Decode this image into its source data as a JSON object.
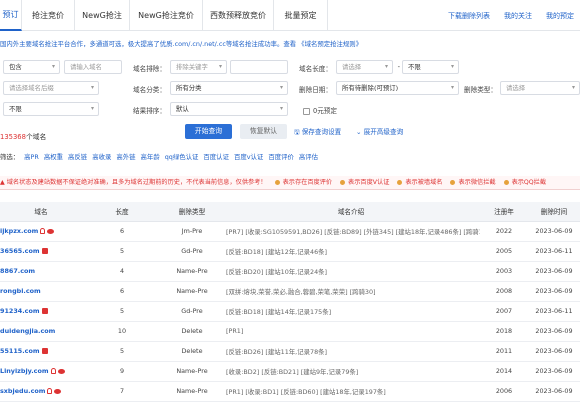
{
  "nav": {
    "tabs": [
      {
        "label": "预订",
        "active": true
      },
      {
        "label": "抢注竞价",
        "active": false
      },
      {
        "label": "NewG抢注",
        "active": false
      },
      {
        "label": "NewG抢注竞价",
        "active": false
      },
      {
        "label": "西数预释放竞价",
        "active": false
      },
      {
        "label": "批量预定",
        "active": false
      }
    ],
    "links": [
      "下载删除列表",
      "我的关注",
      "我的预定"
    ]
  },
  "notice": "国内外主要域名抢注平台合作，多通道可选，极大提高了优质.com/.cn/.net/.cc等域名抢注成功率。查看 《域名预定抢注规则》",
  "form": {
    "row1": {
      "contains_select": "包含",
      "keyword_placeholder": "请输入域名",
      "exclude_label": "域名排除：",
      "exclude_select": "排除关键字",
      "length_label": "域名长度：",
      "length_placeholder": "请选择",
      "length_limit": "不限"
    },
    "row2": {
      "suffix_placeholder": "请选择域名后缀",
      "category_label": "域名分类：",
      "category_value": "所有分类",
      "delete_date_label": "删除日期：",
      "delete_date_value": "所有待删除(可预订)",
      "delete_type_label": "删除类型：",
      "delete_type_placeholder": "请选择"
    },
    "row3": {
      "limit_select": "不限",
      "sort_label": "结果排序：",
      "sort_value": "默认",
      "price_label": "0元预定"
    },
    "row4": {
      "search_button": "开始查询",
      "reset_button": "恢复默认",
      "save_link": "保存查询设置",
      "advanced_link": "展开高级查询"
    }
  },
  "result": {
    "prefix": "共",
    "count": "135368",
    "suffix": "个域名"
  },
  "filters": {
    "label": "筛选：",
    "items": [
      "高PR",
      "高权重",
      "高反链",
      "高收录",
      "高外链",
      "高年龄",
      "qq绿色认证",
      "百度认证",
      "百度v认证",
      "百度评价",
      "高评估"
    ]
  },
  "alert": {
    "text": "域名状态及建站数据不保证绝对准确，且多为域名过期前的历史，不代表当前信息，仅供参考！",
    "legends": [
      "表示存在百度评价",
      "表示百度V认证",
      "表示被墙域名",
      "表示微信拦截",
      "表示QQ拦截"
    ]
  },
  "table": {
    "headers": [
      "域名",
      "长度",
      "删除类型",
      "域名介绍",
      "注册年",
      "删除时间"
    ],
    "rows": [
      {
        "domain": "ijkpzx.com",
        "length": "6",
        "type": "Jm-Pre",
        "intro": "[PR7] [收录:SG1059591,BD26] [反链:BD89] [外链345] [建站18年,记录486条] [跨骑1]",
        "year": "2022",
        "date": "2023-06-09",
        "icons": [
          "lock",
          "chat"
        ]
      },
      {
        "domain": "36565.com",
        "length": "5",
        "type": "Gd-Pre",
        "intro": "[反链:BD18] [建站12年,记录46条]",
        "year": "2005",
        "date": "2023-06-11",
        "icons": [
          "flag"
        ]
      },
      {
        "domain": "8867.com",
        "length": "4",
        "type": "Name-Pre",
        "intro": "[反链:BD20] [建站10年,记录24条]",
        "year": "2003",
        "date": "2023-06-09",
        "icons": []
      },
      {
        "domain": "rongbi.com",
        "length": "6",
        "type": "Name-Pre",
        "intro": "[双拼:熔块,荣誉,荣必,融合,蓉碧,荣笔,荣荣] [跨骑30]",
        "year": "2008",
        "date": "2023-06-09",
        "icons": []
      },
      {
        "domain": "91234.com",
        "length": "5",
        "type": "Gd-Pre",
        "intro": "[反链:BD18] [建站14年,记录175条]",
        "year": "2007",
        "date": "2023-06-11",
        "icons": [
          "flag"
        ]
      },
      {
        "domain": "duidengjia.com",
        "length": "10",
        "type": "Delete",
        "intro": "[PR1]",
        "year": "2018",
        "date": "2023-06-09",
        "icons": []
      },
      {
        "domain": "55115.com",
        "length": "5",
        "type": "Delete",
        "intro": "[反链:BD26] [建站11年,记录78条]",
        "year": "2011",
        "date": "2023-06-09",
        "icons": [
          "flag"
        ]
      },
      {
        "domain": "Linyizbjy.com",
        "length": "9",
        "type": "Name-Pre",
        "intro": "[收录:BD2] [反链:BD21] [建站9年,记录79条]",
        "year": "2014",
        "date": "2023-06-09",
        "icons": [
          "lock",
          "chat"
        ]
      },
      {
        "domain": "sxbjedu.com",
        "length": "7",
        "type": "Name-Pre",
        "intro": "[PR1] [收录:BD1] [反链:BD60] [建站18年,记录197条]",
        "year": "2006",
        "date": "2023-06-09",
        "icons": [
          "lock",
          "chat"
        ]
      }
    ]
  },
  "colors": {
    "accent": "#1f62c9",
    "primary_button": "#2b6fd6",
    "alert_red": "#dd3333"
  }
}
